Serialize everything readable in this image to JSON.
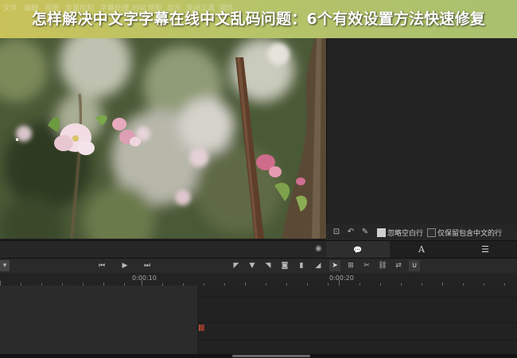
{
  "banner": {
    "title": "怎样解决中文字字幕在线中文乱码问题：6个有效设置方法快速修复"
  },
  "menubar": {
    "items": [
      "文件",
      "编辑",
      "视图",
      "变量控制",
      "字幕处理",
      "时间",
      "帮助",
      "显示",
      "关闭工具",
      "插件"
    ]
  },
  "subtitle_options": {
    "ignore_empty_lines": "忽略空白行",
    "keep_chinese_lines_only": "仅保留包含中文的行"
  },
  "tabs": {
    "active": "speech",
    "icons": [
      "speech-bubble-icon",
      "text-A-icon",
      "list-icon"
    ],
    "glyphs": [
      "💬",
      "A",
      "☰"
    ]
  },
  "timeline": {
    "tick_labels": [
      "0:00:10",
      "0:00:20"
    ]
  },
  "colors": {
    "banner_start": "#c9c25a",
    "banner_end": "#a9c06e",
    "app_bg": "#1e1e1e",
    "panel_bg": "#232323",
    "marker": "#b0402a"
  }
}
